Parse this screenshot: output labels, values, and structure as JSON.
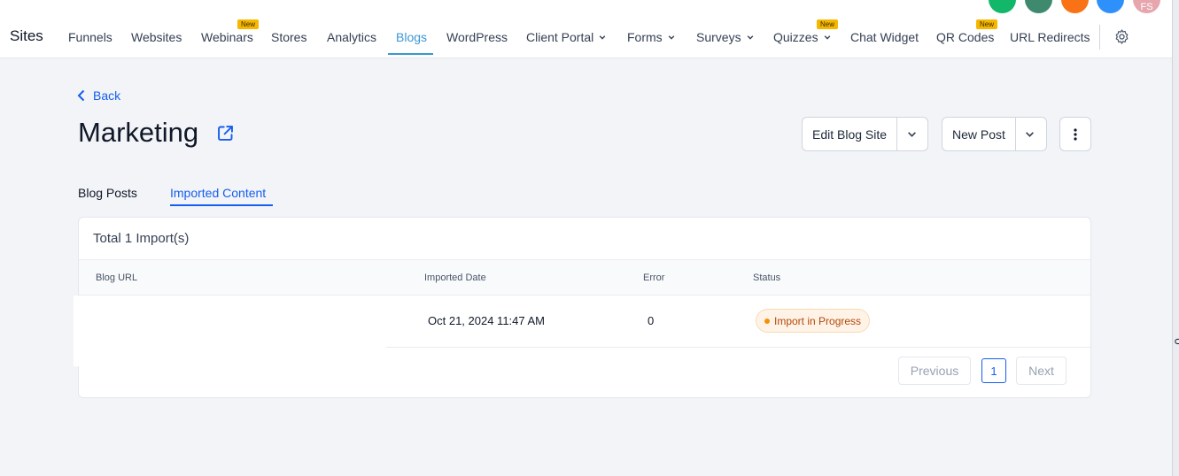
{
  "nav": {
    "brand": "Sites",
    "items": [
      {
        "label": "Funnels"
      },
      {
        "label": "Websites"
      },
      {
        "label": "Webinars",
        "badge": "New"
      },
      {
        "label": "Stores"
      },
      {
        "label": "Analytics"
      },
      {
        "label": "Blogs",
        "active": true
      },
      {
        "label": "WordPress"
      },
      {
        "label": "Client Portal",
        "dropdown": true
      },
      {
        "label": "Forms",
        "dropdown": true
      },
      {
        "label": "Surveys",
        "dropdown": true
      },
      {
        "label": "Quizzes",
        "dropdown": true,
        "badge": "New"
      },
      {
        "label": "Chat Widget"
      },
      {
        "label": "QR Codes",
        "badge": "New"
      },
      {
        "label": "URL Redirects"
      }
    ],
    "settings_icon": "gear-icon",
    "avatar_initials": "FS"
  },
  "colors": {
    "accent": "#155eef",
    "nav_active": "#3b97d3",
    "badge_new": "#f5b700",
    "status_progress": "#b54708"
  },
  "page": {
    "back_label": "Back",
    "title": "Marketing",
    "edit_blog_site_label": "Edit Blog Site",
    "new_post_label": "New Post"
  },
  "tabs": [
    {
      "label": "Blog Posts"
    },
    {
      "label": "Imported Content",
      "active": true
    }
  ],
  "imports": {
    "total_label": "Total 1 Import(s)",
    "columns": [
      "Blog URL",
      "Imported Date",
      "Error",
      "Status"
    ],
    "rows": [
      {
        "blog_url": "",
        "imported_date": "Oct 21, 2024 11:47 AM",
        "error": "0",
        "status": "Import in Progress"
      }
    ]
  },
  "pagination": {
    "previous_label": "Previous",
    "current_page": "1",
    "next_label": "Next"
  }
}
